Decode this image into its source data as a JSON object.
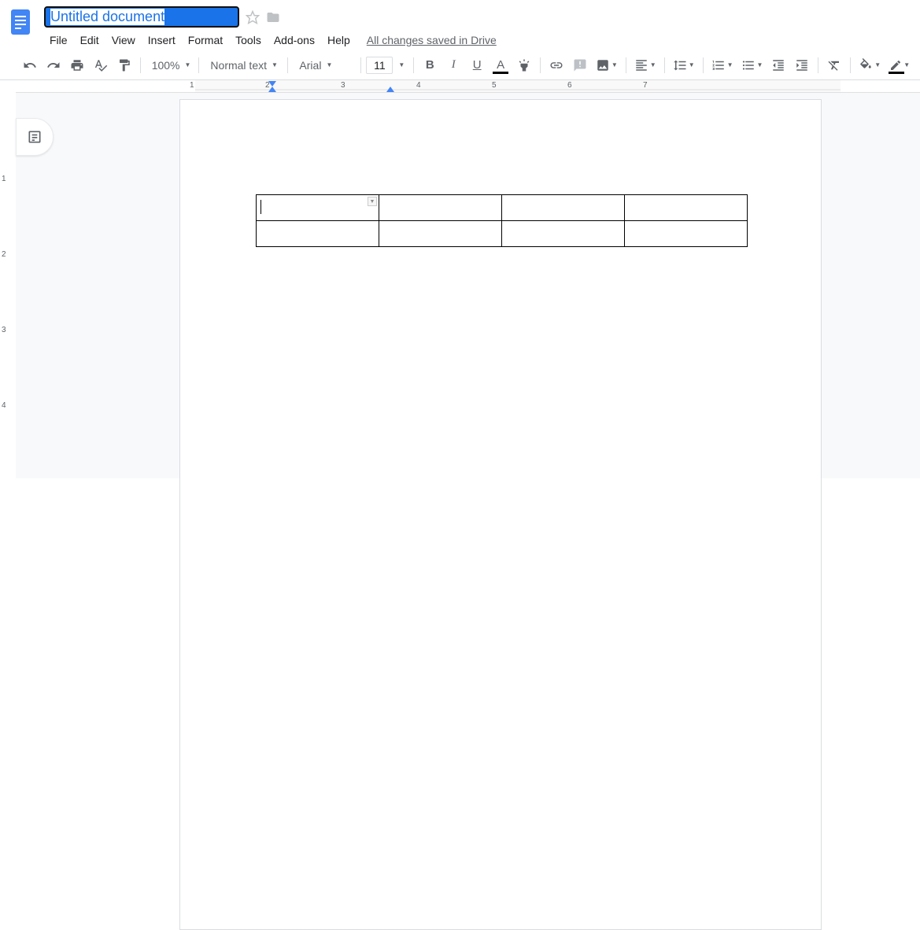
{
  "header": {
    "title": "Untitled document",
    "menus": [
      "File",
      "Edit",
      "View",
      "Insert",
      "Format",
      "Tools",
      "Add-ons",
      "Help"
    ],
    "save_status": "All changes saved in Drive"
  },
  "toolbar": {
    "zoom": "100%",
    "style": "Normal text",
    "font": "Arial",
    "font_size": "11",
    "text_color": "#000000",
    "highlight_color": "#ffffff"
  },
  "document": {
    "table": {
      "rows": 2,
      "cols": 4
    }
  },
  "ruler": {
    "numbers": [
      1,
      2,
      3,
      4,
      5,
      6,
      7
    ]
  }
}
